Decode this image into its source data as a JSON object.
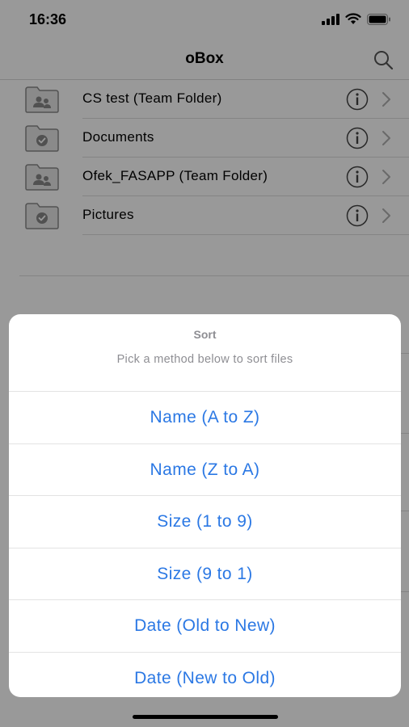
{
  "status_bar": {
    "time": "16:36"
  },
  "nav": {
    "title": "oBox"
  },
  "folders": [
    {
      "name": "CS test (Team Folder)",
      "type": "team"
    },
    {
      "name": "Documents",
      "type": "synced"
    },
    {
      "name": "Ofek_FASAPP (Team Folder)",
      "type": "team"
    },
    {
      "name": "Pictures",
      "type": "synced"
    }
  ],
  "sort_sheet": {
    "title": "Sort",
    "subtitle": "Pick a method below to sort files",
    "options": [
      "Name (A to Z)",
      "Name (Z to A)",
      "Size (1 to 9)",
      "Size (9 to 1)",
      "Date (Old to New)",
      "Date (New to Old)"
    ]
  },
  "colors": {
    "accent": "#2b78e4",
    "dim_overlay": "rgba(0,0,0,0.4)"
  }
}
